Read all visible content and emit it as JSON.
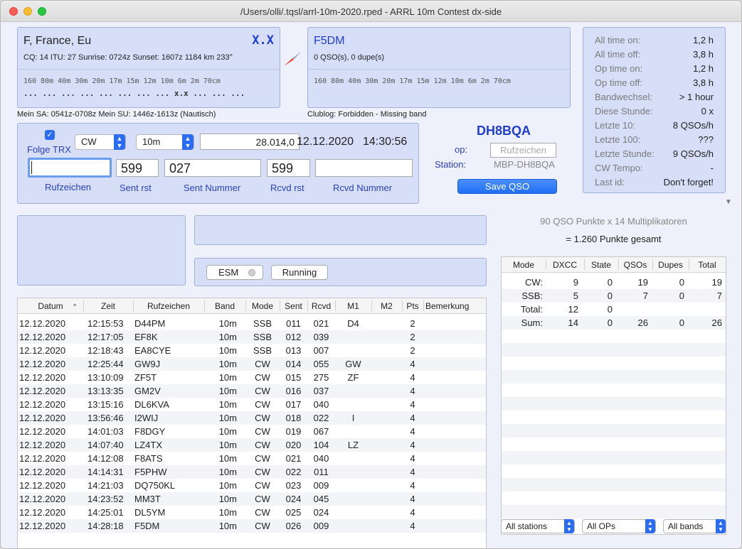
{
  "window": {
    "title": "/Users/olli/.tqsl/arrl-10m-2020.rped - ARRL 10m Contest dx-side"
  },
  "country_panel": {
    "name": "F, France, Eu",
    "flag_code": "X.X",
    "info": "CQ: 14  ITU: 27  Sunrise: 0724z  Sunset: 1607z  1184 km  233°",
    "bands_header": "160  80m  40m  30m  20m  17m  15m  12m  10m   6m   2m  70cm",
    "bands_status": "... ...  ...  ...  ...  ...  ...  ...  x.x  ...  ...  ...",
    "footer": "Mein SA: 0541z-0708z  Mein SU: 1446z-1613z (Nautisch)"
  },
  "callsign_panel": {
    "call": "F5DM",
    "dupe_info": "0 QSO(s), 0 dupe(s)",
    "bands_header": "160  80m  40m  30m  20m  17m  15m  12m  10m   6m   2m  70cm",
    "footer": "Clublog: Forbidden - Missing band"
  },
  "stats_panel": {
    "rows": [
      {
        "k": "All time on:",
        "v": "1,2 h"
      },
      {
        "k": "All time off:",
        "v": "3,8 h"
      },
      {
        "k": "Op time on:",
        "v": "1,2 h"
      },
      {
        "k": "Op time off:",
        "v": "3,8 h"
      },
      {
        "k": "Bandwechsel:",
        "v": "> 1 hour"
      },
      {
        "k": "Diese Stunde:",
        "v": "0 x"
      },
      {
        "k": "Letzte 10:",
        "v": "8 QSOs/h"
      },
      {
        "k": "Letzte 100:",
        "v": "???"
      },
      {
        "k": "Letzte Stunde:",
        "v": "9 QSOs/h"
      },
      {
        "k": "CW Tempo:",
        "v": "-"
      },
      {
        "k": "Last id:",
        "v": "Don't forget!"
      }
    ]
  },
  "entry": {
    "folge_trx_label": "Folge TRX",
    "mode": "CW",
    "band": "10m",
    "frequency": "28.014,0",
    "date": "12.12.2020",
    "time": "14:30:56",
    "call_value": "",
    "sent_rst": "599",
    "sent_nr": "027",
    "rcvd_rst": "599",
    "rcvd_nr": "",
    "labels": {
      "call": "Rufzeichen",
      "sent_rst": "Sent rst",
      "sent_nr": "Sent Nummer",
      "rcvd_rst": "Rcvd rst",
      "rcvd_nr": "Rcvd Nummer"
    }
  },
  "station": {
    "callsign": "DH8BQA",
    "op_label": "op:",
    "op_placeholder": "Rufzeichen",
    "station_label": "Station:",
    "station_value": "MBP-DH8BQA",
    "save_label": "Save QSO"
  },
  "score": {
    "line1": "90 QSO Punkte x 14 Multiplikatoren",
    "line2": "= 1.260 Punkte gesamt"
  },
  "controls": {
    "esm_label": "ESM",
    "running_label": "Running"
  },
  "log": {
    "columns": [
      "Datum",
      "Zeit",
      "Rufzeichen",
      "Band",
      "Mode",
      "Sent",
      "Rcvd",
      "M1",
      "M2",
      "Pts",
      "Bemerkung"
    ],
    "rows": [
      [
        "12.12.2020",
        "12:15:53",
        "D44PM",
        "10m",
        "SSB",
        "011",
        "021",
        "D4",
        "",
        "2",
        ""
      ],
      [
        "12.12.2020",
        "12:17:05",
        "EF8K",
        "10m",
        "SSB",
        "012",
        "039",
        "",
        "",
        "2",
        ""
      ],
      [
        "12.12.2020",
        "12:18:43",
        "EA8CYE",
        "10m",
        "SSB",
        "013",
        "007",
        "",
        "",
        "2",
        ""
      ],
      [
        "12.12.2020",
        "12:25:44",
        "GW9J",
        "10m",
        "CW",
        "014",
        "055",
        "GW",
        "",
        "4",
        ""
      ],
      [
        "12.12.2020",
        "13:10:09",
        "ZF5T",
        "10m",
        "CW",
        "015",
        "275",
        "ZF",
        "",
        "4",
        ""
      ],
      [
        "12.12.2020",
        "13:13:35",
        "GM2V",
        "10m",
        "CW",
        "016",
        "037",
        "",
        "",
        "4",
        ""
      ],
      [
        "12.12.2020",
        "13:15:16",
        "DL6KVA",
        "10m",
        "CW",
        "017",
        "040",
        "",
        "",
        "4",
        ""
      ],
      [
        "12.12.2020",
        "13:56:46",
        "I2WIJ",
        "10m",
        "CW",
        "018",
        "022",
        "I",
        "",
        "4",
        ""
      ],
      [
        "12.12.2020",
        "14:01:03",
        "F8DGY",
        "10m",
        "CW",
        "019",
        "067",
        "",
        "",
        "4",
        ""
      ],
      [
        "12.12.2020",
        "14:07:40",
        "LZ4TX",
        "10m",
        "CW",
        "020",
        "104",
        "LZ",
        "",
        "4",
        ""
      ],
      [
        "12.12.2020",
        "14:12:08",
        "F8ATS",
        "10m",
        "CW",
        "021",
        "040",
        "",
        "",
        "4",
        ""
      ],
      [
        "12.12.2020",
        "14:14:31",
        "F5PHW",
        "10m",
        "CW",
        "022",
        "011",
        "",
        "",
        "4",
        ""
      ],
      [
        "12.12.2020",
        "14:21:03",
        "DQ750KL",
        "10m",
        "CW",
        "023",
        "009",
        "",
        "",
        "4",
        ""
      ],
      [
        "12.12.2020",
        "14:23:52",
        "MM3T",
        "10m",
        "CW",
        "024",
        "045",
        "",
        "",
        "4",
        ""
      ],
      [
        "12.12.2020",
        "14:25:01",
        "DL5YM",
        "10m",
        "CW",
        "025",
        "024",
        "",
        "",
        "4",
        ""
      ],
      [
        "12.12.2020",
        "14:28:18",
        "F5DM",
        "10m",
        "CW",
        "026",
        "009",
        "",
        "",
        "4",
        ""
      ]
    ]
  },
  "summary": {
    "columns": [
      "Mode",
      "DXCC",
      "State",
      "QSOs",
      "Dupes",
      "Total"
    ],
    "rows": [
      [
        "CW:",
        "9",
        "0",
        "19",
        "0",
        "19"
      ],
      [
        "SSB:",
        "5",
        "0",
        "7",
        "0",
        "7"
      ],
      [
        "Total:",
        "12",
        "0",
        "",
        "",
        ""
      ],
      [
        "Sum:",
        "14",
        "0",
        "26",
        "0",
        "26"
      ]
    ]
  },
  "filters": {
    "stations": "All stations",
    "ops": "All OPs",
    "bands": "All bands"
  }
}
